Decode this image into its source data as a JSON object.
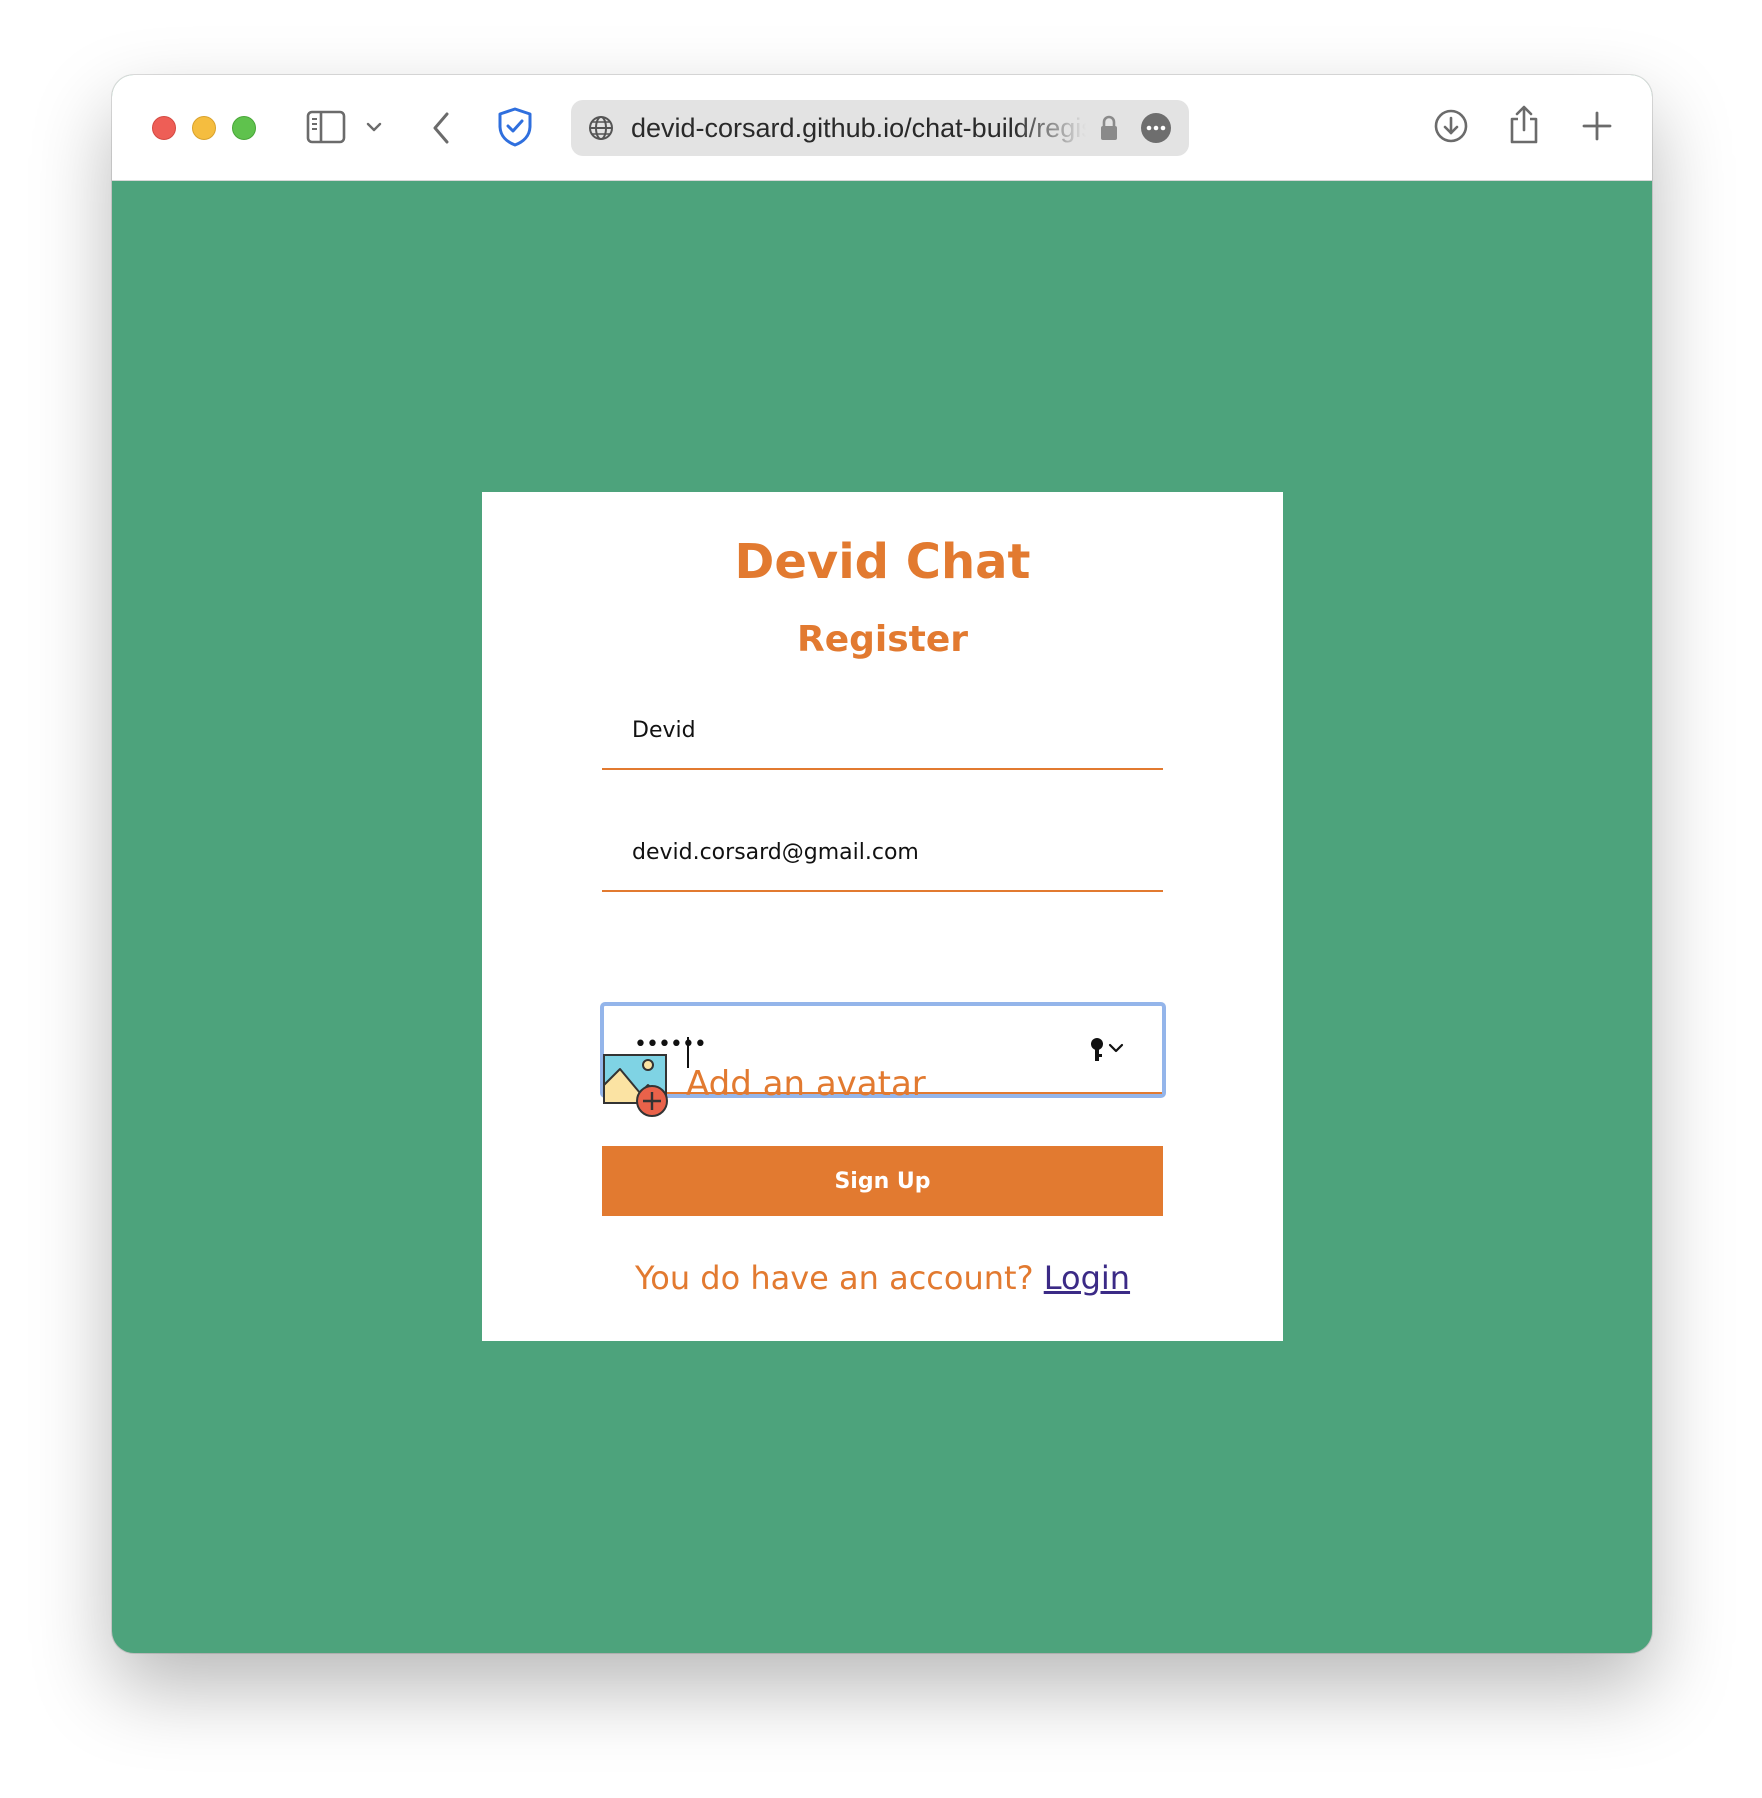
{
  "browser": {
    "url": "devid-corsard.github.io/chat-build/register",
    "toolbar_icons": [
      "sidebar-icon",
      "chevron-down-icon",
      "back-arrow-icon",
      "privacy-shield-icon",
      "globe-icon",
      "lock-icon",
      "more-icon",
      "download-icon",
      "share-icon",
      "new-tab-icon"
    ]
  },
  "page": {
    "background_color": "#4da37c",
    "accent_color": "#e27a30",
    "link_color": "#3b2a86"
  },
  "app": {
    "title": "Devid Chat"
  },
  "form": {
    "title": "Register",
    "name_value": "Devid",
    "email_value": "devid.corsard@gmail.com",
    "password_mask": "••••••",
    "avatar_label": "Add an avatar",
    "submit_label": "Sign Up",
    "footer_text": "You do have an account? ",
    "login_label": "Login"
  }
}
